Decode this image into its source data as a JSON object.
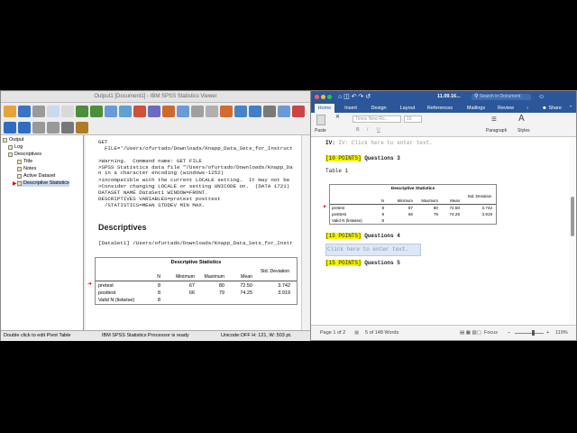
{
  "spss": {
    "title": "Output1 [Document1] - IBM SPSS Statistics Viewer",
    "tree": [
      {
        "label": "Output"
      },
      {
        "label": "Log"
      },
      {
        "label": "Descriptives"
      },
      {
        "label": "Title"
      },
      {
        "label": "Notes"
      },
      {
        "label": "Active Dataset"
      },
      {
        "label": "Descriptive Statistics"
      }
    ],
    "syntax": [
      "GET",
      "  FILE='/Users/ofurtado/Downloads/Knapp_Data_Sets_for_Instruct",
      "",
      ">Warning.  Command name: GET FILE",
      ">SPSS Statistics data file \"/Users/ofurtado/Downloads/Knapp_Da",
      "n in a character encoding (windows-1252)",
      ">incompatible with the current LOCALE setting.  It may not be",
      ">Consider changing LOCALE or setting UNICODE on.  (DATA 1721)",
      "DATASET NAME DataSet1 WINDOW=FRONT.",
      "DESCRIPTIVES VARIABLES=pretest posttest",
      "  /STATISTICS=MEAN STDDEV MIN MAX."
    ],
    "section_heading": "Descriptives",
    "dataset_line": "[DataSet1] /Users/ofurtado/Downloads/Knapp_Data_Sets_for_Instr",
    "status_left": "Double click to edit Pivot Table",
    "status_mid": "IBM SPSS Statistics Processor is ready",
    "status_right": "Unicode:OFF H: 121, W: 503 pt."
  },
  "stats_table": {
    "title": "Descriptive Statistics",
    "columns": [
      "N",
      "Minimum",
      "Maximum",
      "Mean",
      "Std. Deviation"
    ],
    "rows": [
      {
        "label": "pretest",
        "n": "8",
        "min": "67",
        "max": "80",
        "mean": "72.50",
        "sd": "3.742"
      },
      {
        "label": "posttest",
        "n": "8",
        "min": "66",
        "max": "79",
        "mean": "74.25",
        "sd": "3.919"
      },
      {
        "label": "Valid N (listwise)",
        "n": "8",
        "min": "",
        "max": "",
        "mean": "",
        "sd": ""
      }
    ]
  },
  "word": {
    "title": "11.09.16...",
    "search_placeholder": "Search in Document",
    "tabs": [
      "Home",
      "Insert",
      "Design",
      "Layout",
      "References",
      "Mailings",
      "Review"
    ],
    "share_label": "Share",
    "font_name": "Times New Ro...",
    "font_size": "10",
    "paste_label": "Paste",
    "paragraph_label": "Paragraph",
    "styles_label": "Styles",
    "doc": {
      "line_iv": "IV: Click here to enter text.",
      "q3_points": "[10 POINTS]",
      "q3_label": " Questions 3",
      "table_label": "Table 1",
      "q4_points": "[15 POINTS]",
      "q4_label": " Questions 4",
      "placeholder": "Click here to enter text.",
      "q5_points": "[15 POINTS]",
      "q5_label": " Questions 5"
    },
    "status_page": "Page 1 of 2",
    "status_words": "5 of 148 Words",
    "focus_label": "Focus",
    "zoom": "119%"
  }
}
